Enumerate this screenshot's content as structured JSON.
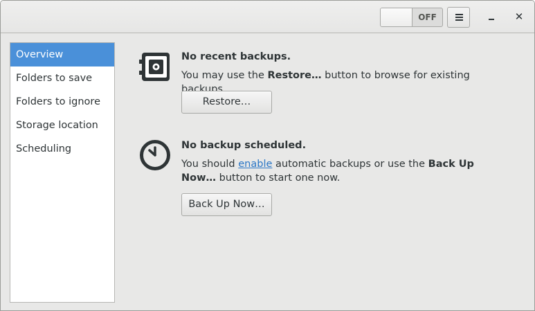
{
  "header": {
    "switch_label": "OFF",
    "menu_icon": "hamburger-menu-icon",
    "minimize_icon": "minimize-icon",
    "close_icon": "close-icon",
    "close_glyph": "✕"
  },
  "sidebar": {
    "items": [
      {
        "label": "Overview",
        "selected": true
      },
      {
        "label": "Folders to save",
        "selected": false
      },
      {
        "label": "Folders to ignore",
        "selected": false
      },
      {
        "label": "Storage location",
        "selected": false
      },
      {
        "label": "Scheduling",
        "selected": false
      }
    ]
  },
  "backups": {
    "icon": "safe-icon",
    "title": "No recent backups.",
    "desc_before": "You may use the ",
    "desc_bold": "Restore…",
    "desc_after": " button to browse for existing backups.",
    "button": "Restore…"
  },
  "schedule": {
    "icon": "clock-icon",
    "title": "No backup scheduled.",
    "desc_before": "You should ",
    "desc_link": "enable",
    "desc_middle": " automatic backups or use the ",
    "desc_bold": "Back Up Now…",
    "desc_after": " button to start one now.",
    "button": "Back Up Now…"
  },
  "colors": {
    "accent": "#4a90d9",
    "link": "#2a76c6",
    "background": "#e8e8e7"
  }
}
